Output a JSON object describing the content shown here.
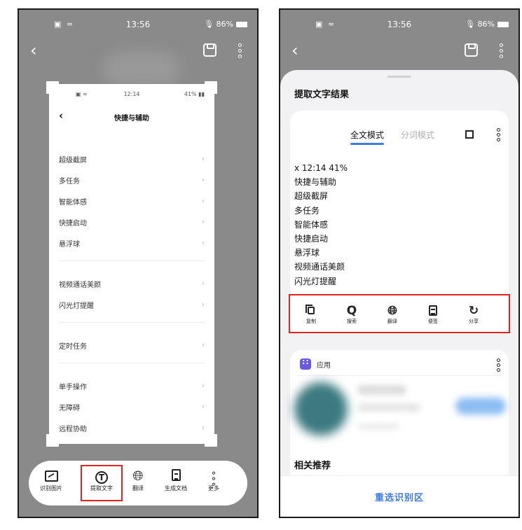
{
  "status": {
    "left_icons": "▣ ≈",
    "left_time": "13:56",
    "right_time": "13:56",
    "battery": "86%",
    "mic": "🎙"
  },
  "left_phone": {
    "captured": {
      "status_left": "▣ ≈",
      "status_time": "12:14",
      "status_batt": "41% ▮▮",
      "title": "快捷与辅助",
      "rows": [
        "超级截屏",
        "多任务",
        "智能体感",
        "快捷启动",
        "悬浮球",
        "视频通话美颜",
        "闪光灯提醒",
        "定时任务",
        "单手操作",
        "无障碍",
        "远程协助"
      ]
    },
    "toolbar": [
      {
        "label": "识别图片",
        "icon": "image-icon"
      },
      {
        "label": "提取文字",
        "icon": "text-t-icon",
        "selected": true
      },
      {
        "label": "翻译",
        "icon": "globe-icon"
      },
      {
        "label": "生成文档",
        "icon": "document-icon"
      },
      {
        "label": "更多",
        "icon": "more-icon"
      }
    ]
  },
  "right_phone": {
    "sheet_title": "提取文字结果",
    "tabs": {
      "full": "全文模式",
      "word": "分词模式"
    },
    "lines": [
      "x 12:14 41%",
      "快捷与辅助",
      "超级截屏",
      "多任务",
      "智能体感",
      "快捷启动",
      "悬浮球",
      "视频通话美颜",
      "闪光灯提醒"
    ],
    "actions": [
      {
        "label": "复制",
        "icon": "copy-icon"
      },
      {
        "label": "搜索",
        "icon": "search-icon"
      },
      {
        "label": "翻译",
        "icon": "globe-icon"
      },
      {
        "label": "便签",
        "icon": "note-icon"
      },
      {
        "label": "分享",
        "icon": "share-icon"
      }
    ],
    "app_section": "应用",
    "related_title": "相关推荐",
    "reselect": "重选识别区"
  },
  "colors": {
    "accent": "#3f7be0",
    "highlight": "#e0231c",
    "backdrop": "#8a8a8a",
    "sheet": "#f2f2f4"
  }
}
